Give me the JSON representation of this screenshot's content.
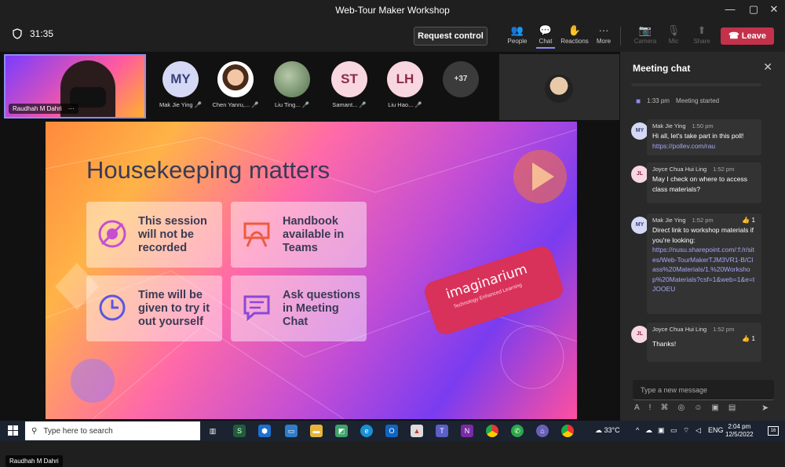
{
  "window": {
    "title": "Web-Tour Maker Workshop"
  },
  "toolbar": {
    "timer": "31:35",
    "request_control": "Request control",
    "people": "People",
    "chat": "Chat",
    "reactions": "Reactions",
    "more": "More",
    "camera": "Camera",
    "mic": "Mic",
    "share": "Share",
    "leave": "Leave",
    "more_glyph": "···"
  },
  "self_tile": {
    "name": "Raudhah M Dahri"
  },
  "participants": [
    {
      "initials": "MY",
      "label": "Mak Jie Ying",
      "color": "#d5d9f5",
      "text_color": "#3a3f7a"
    },
    {
      "initials": "",
      "label": "Chen Yanru,...",
      "color": "#ffffff",
      "text_color": "#000"
    },
    {
      "initials": "",
      "label": "Liu Ting...",
      "color": "#6e8f6a",
      "text_color": "#000"
    },
    {
      "initials": "ST",
      "label": "Samant...",
      "color": "#f8d7e0",
      "text_color": "#8a2a4a"
    },
    {
      "initials": "LH",
      "label": "Liu Hao...",
      "color": "#f8d7e0",
      "text_color": "#8a2a4a"
    }
  ],
  "overflow_count": "+37",
  "slide": {
    "title": "Housekeeping matters",
    "cards": [
      {
        "text": "This session\nwill not be\nrecorded"
      },
      {
        "text": "Handbook\navailable in\nTeams"
      },
      {
        "text": "Time will be\ngiven to try it\nout yourself"
      },
      {
        "text": "Ask questions\nin Meeting\nChat"
      }
    ],
    "brand_name": "imaginarium",
    "brand_tagline": "Technology Enhanced Learning",
    "presenter_label": "Raudhah M Dahri",
    "colors": {
      "title": "#3a3a55",
      "accent": "#d8315a"
    }
  },
  "chat": {
    "header": "Meeting chat",
    "meeting_started_time": "1:33 pm",
    "meeting_started_text": "Meeting started",
    "messages": [
      {
        "initials": "MY",
        "author": "Mak Jie Ying",
        "time": "1:50 pm",
        "body": "Hi all, let's take part in this poll!",
        "link": "https://pollev.com/rau",
        "reaction": "",
        "avatar_color": "#d5d9f5"
      },
      {
        "initials": "JL",
        "author": "Joyce Chua Hui Ling",
        "time": "1:52 pm",
        "body": "May I check on where to access class materials?",
        "link": "",
        "reaction": "",
        "avatar_color": "#f8d7e0"
      },
      {
        "initials": "MY",
        "author": "Mak Jie Ying",
        "time": "1:52 pm",
        "body": "Direct link to workshop materials if you're looking:",
        "link": "https://nusu.sharepoint.com/:f:/r/sites/Web-TourMakerTJM3VR1-B/Class%20Materials/1.%20Workshop%20Materials?csf=1&web=1&e=tJOOEU",
        "reaction": "👍 1",
        "avatar_color": "#d5d9f5"
      },
      {
        "initials": "JL",
        "author": "Joyce Chua Hui Ling",
        "time": "1:52 pm",
        "body": "Thanks!",
        "link": "",
        "reaction": "👍 1",
        "avatar_color": "#f8d7e0"
      }
    ],
    "input_placeholder": "Type a new message"
  },
  "taskbar": {
    "search_placeholder": "Type here to search",
    "weather": "33°C",
    "language": "ENG",
    "time": "2:04 pm",
    "date": "12/5/2022",
    "notifications": "16"
  }
}
